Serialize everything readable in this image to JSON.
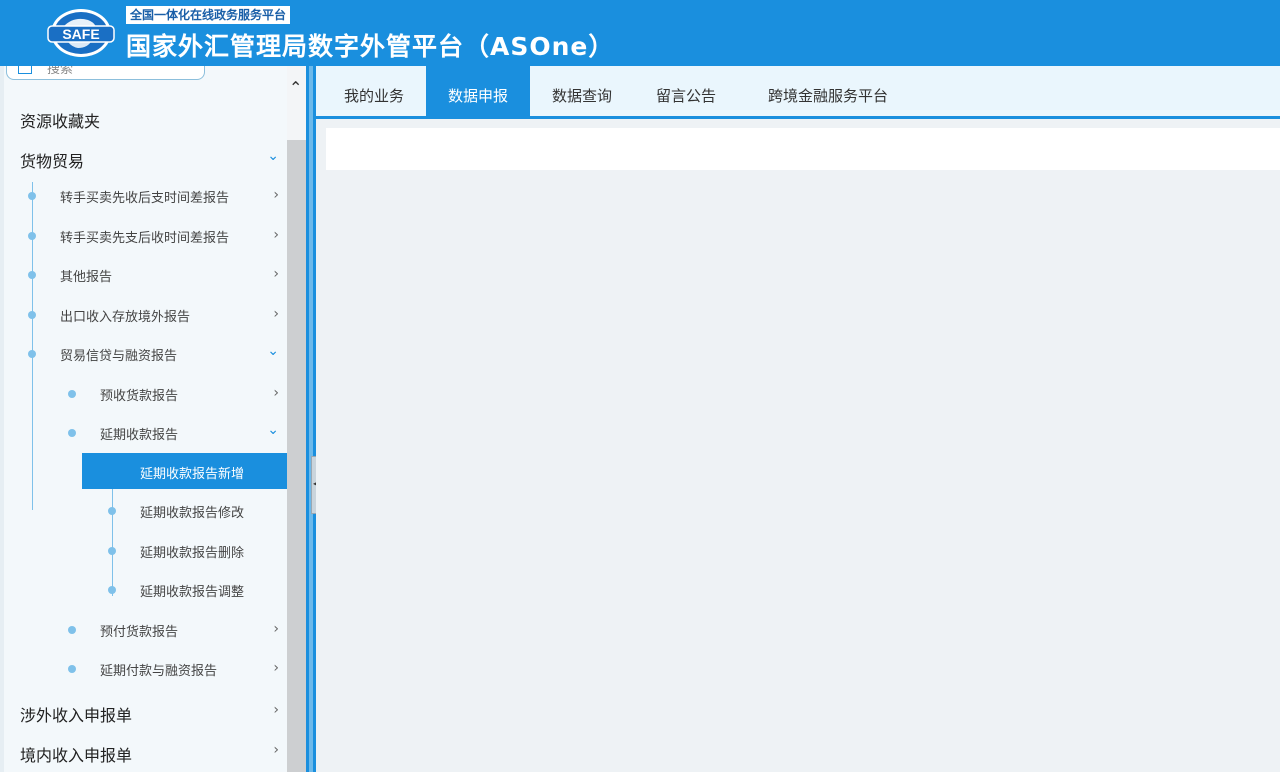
{
  "header": {
    "logo_text": "SAFE",
    "tagline": "全国一体化在线政务服务平台",
    "title": "国家外汇管理局数字外管平台（ASOne）"
  },
  "sidebar": {
    "search_label": "搜索",
    "favorites": "资源收藏夹",
    "group_goods": "货物贸易",
    "items": [
      "转手买卖先收后支时间差报告",
      "转手买卖先支后收时间差报告",
      "其他报告",
      "出口收入存放境外报告",
      "贸易信贷与融资报告"
    ],
    "sub_items": [
      "预收货款报告",
      "延期收款报告"
    ],
    "leaf_items": [
      "延期收款报告新增",
      "延期收款报告修改",
      "延期收款报告删除",
      "延期收款报告调整"
    ],
    "sub_items_after": [
      "预付货款报告",
      "延期付款与融资报告"
    ],
    "groups_after": [
      "涉外收入申报单",
      "境内收入申报单"
    ]
  },
  "tabs": [
    "我的业务",
    "数据申报",
    "数据查询",
    "留言公告",
    "跨境金融服务平台"
  ],
  "active_tab": "数据申报",
  "colors": {
    "accent": "#1a8fde",
    "header_bg": "#1a8fde"
  }
}
